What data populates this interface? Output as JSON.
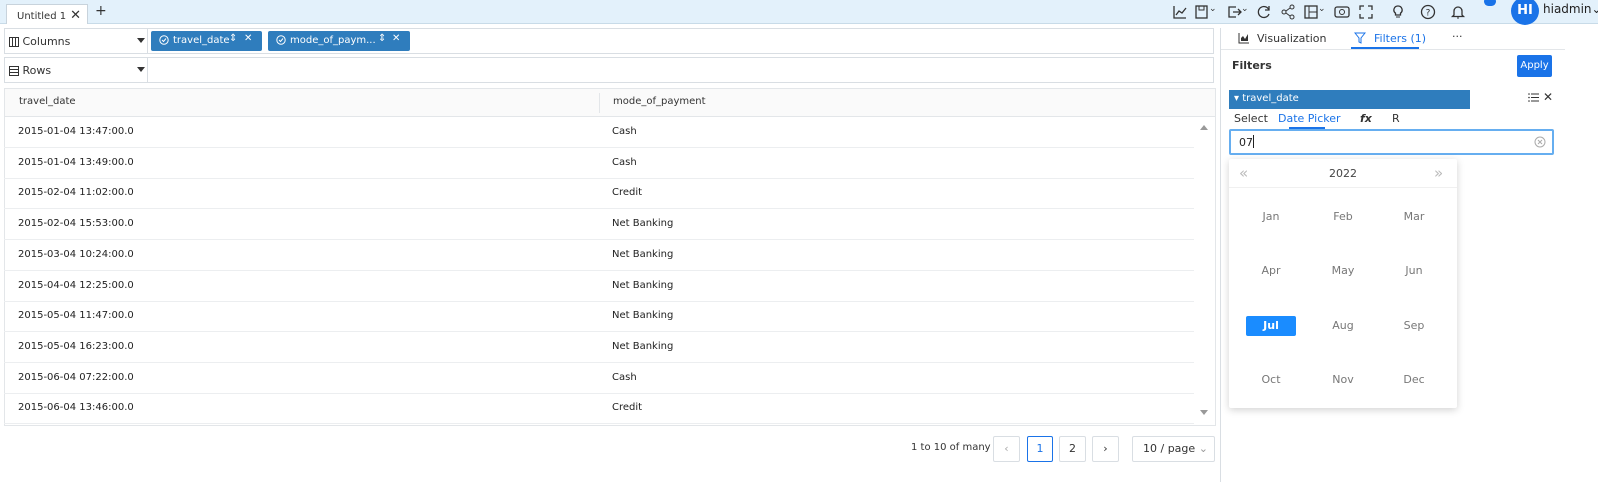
{
  "tabs": [
    {
      "label": "Untitled 1"
    }
  ],
  "user": {
    "initials": "HI",
    "name": "hiadmin"
  },
  "shelves": {
    "columns_label": "Columns",
    "rows_label": "Rows",
    "column_chips": [
      {
        "label": "travel_date"
      },
      {
        "label": "mode_of_paym..."
      }
    ]
  },
  "grid": {
    "columns": [
      "travel_date",
      "mode_of_payment"
    ],
    "rows": [
      [
        "2015-01-04 13:47:00.0",
        "Cash"
      ],
      [
        "2015-01-04 13:49:00.0",
        "Cash"
      ],
      [
        "2015-02-04 11:02:00.0",
        "Credit"
      ],
      [
        "2015-02-04 15:53:00.0",
        "Net Banking"
      ],
      [
        "2015-03-04 10:24:00.0",
        "Net Banking"
      ],
      [
        "2015-04-04 12:25:00.0",
        "Net Banking"
      ],
      [
        "2015-05-04 11:47:00.0",
        "Net Banking"
      ],
      [
        "2015-05-04 16:23:00.0",
        "Net Banking"
      ],
      [
        "2015-06-04 07:22:00.0",
        "Cash"
      ],
      [
        "2015-06-04 13:46:00.0",
        "Credit"
      ]
    ]
  },
  "pagination": {
    "summary": "1 to 10 of many",
    "pages": [
      "1",
      "2"
    ],
    "current": "1",
    "page_size": "10 / page"
  },
  "panel": {
    "tabs": {
      "visualization": "Visualization",
      "filters": "Filters (1)",
      "more": "···"
    },
    "filters_title": "Filters",
    "apply_label": "Apply",
    "filter": {
      "field": "travel_date",
      "modes": [
        "Select",
        "Date Picker",
        "fx",
        "R"
      ],
      "active_mode": "Date Picker",
      "input_value": "07"
    },
    "datepicker": {
      "year": "2022",
      "prev": "«",
      "next": "»",
      "months": [
        "Jan",
        "Feb",
        "Mar",
        "Apr",
        "May",
        "Jun",
        "Jul",
        "Aug",
        "Sep",
        "Oct",
        "Nov",
        "Dec"
      ],
      "selected": "Jul"
    }
  },
  "colors": {
    "accent": "#1a73e8",
    "chip": "#2f7dbd",
    "topbar": "#e3f1fb"
  }
}
